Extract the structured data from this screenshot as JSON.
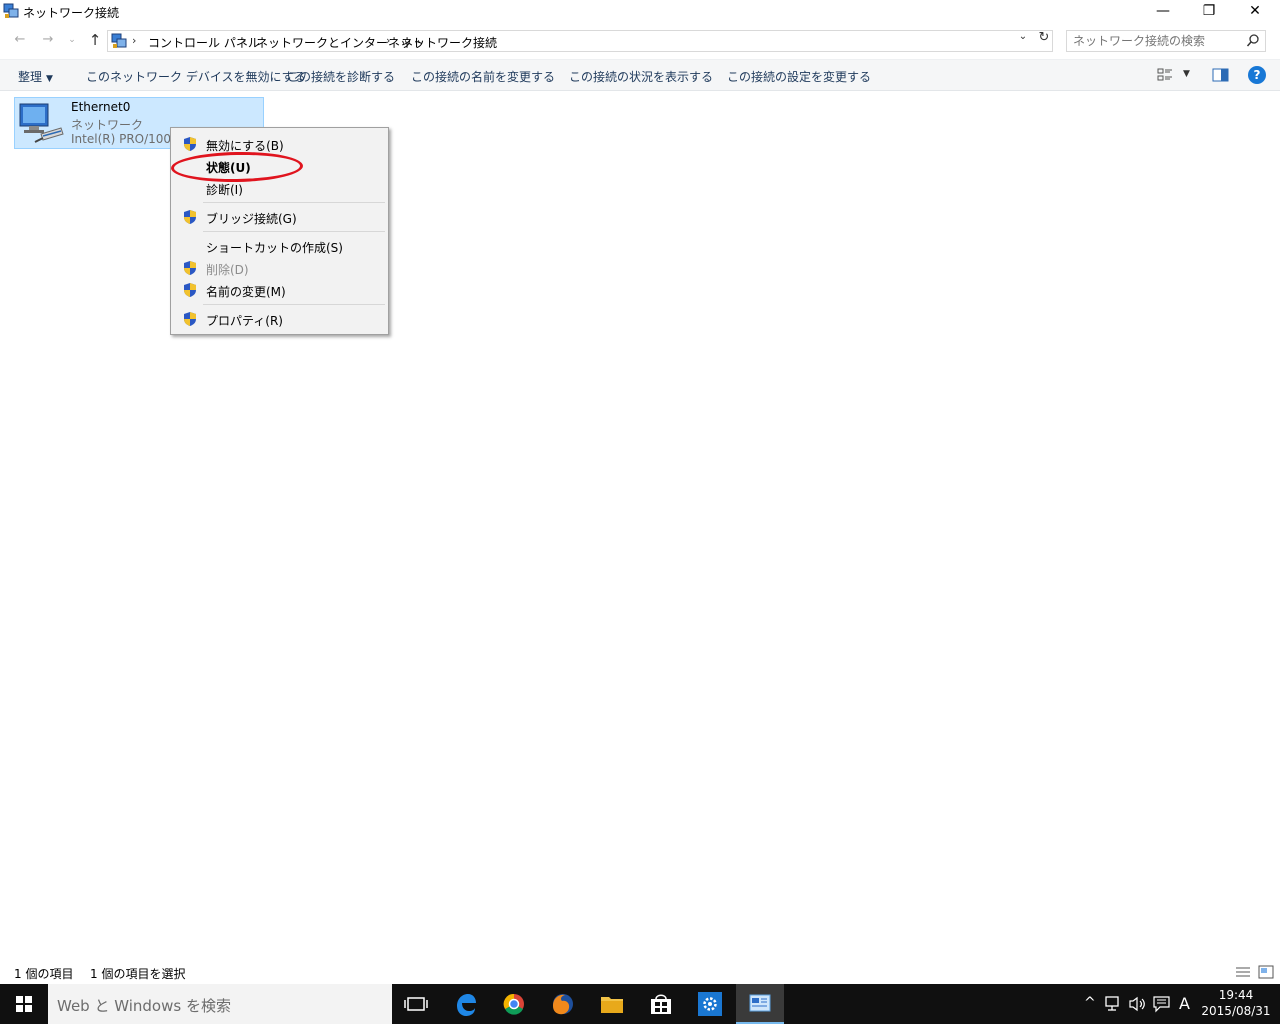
{
  "window": {
    "title": "ネットワーク接続",
    "min_glyph": "—",
    "max_glyph": "❐",
    "close_glyph": "✕"
  },
  "nav": {
    "back_glyph": "←",
    "forward_glyph": "→",
    "history_glyph": "⌄",
    "up_glyph": "↑",
    "breadcrumb": [
      "コントロール パネル",
      "ネットワークとインターネット",
      "ネットワーク接続"
    ],
    "separator": "›",
    "dropdown_glyph": "⌄",
    "refresh_glyph": "↻"
  },
  "search": {
    "placeholder": "ネットワーク接続の検索"
  },
  "toolbar": {
    "organize": "整理",
    "organize_caret": "▼",
    "commands": [
      "このネットワーク デバイスを無効にする",
      "この接続を診断する",
      "この接続の名前を変更する",
      "この接続の状況を表示する",
      "この接続の設定を変更する"
    ],
    "view_caret": "▼",
    "help": "?"
  },
  "connection": {
    "name": "Ethernet0",
    "network": "ネットワーク",
    "adapter": "Intel(R) PRO/1000 M"
  },
  "context_menu": {
    "items": [
      {
        "label": "無効にする(B)",
        "shield": true,
        "disabled": false,
        "bold": false
      },
      {
        "label": "状態(U)",
        "shield": false,
        "disabled": false,
        "bold": true
      },
      {
        "label": "診断(I)",
        "shield": false,
        "disabled": false,
        "bold": false
      },
      {
        "label": "ブリッジ接続(G)",
        "shield": true,
        "disabled": false,
        "bold": false
      },
      {
        "label": "ショートカットの作成(S)",
        "shield": false,
        "disabled": false,
        "bold": false
      },
      {
        "label": "削除(D)",
        "shield": true,
        "disabled": true,
        "bold": false
      },
      {
        "label": "名前の変更(M)",
        "shield": true,
        "disabled": false,
        "bold": false
      },
      {
        "label": "プロパティ(R)",
        "shield": true,
        "disabled": false,
        "bold": false
      }
    ]
  },
  "annotation_color": "#e0141e",
  "statusbar": {
    "count": "1 個の項目",
    "selected": "1 個の項目を選択"
  },
  "taskbar": {
    "search_placeholder": "Web と Windows を検索",
    "tray_up": "^",
    "ime": "A",
    "time": "19:44",
    "date": "2015/08/31"
  }
}
